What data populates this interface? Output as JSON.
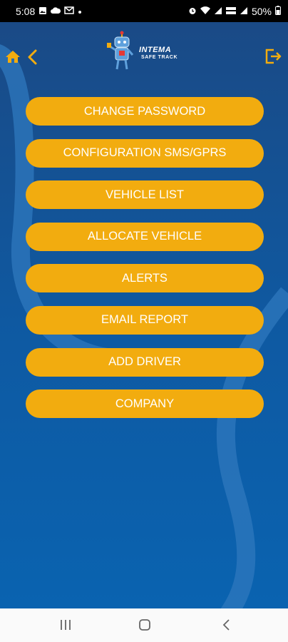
{
  "status_bar": {
    "time": "5:08",
    "battery": "50%",
    "left_icons": [
      "photo-icon",
      "cloud-icon",
      "mail-icon",
      "dot-icon"
    ],
    "right_icons": [
      "alarm-icon",
      "wifi-icon",
      "signal-icon",
      "lte-icon",
      "signal-icon",
      "battery-icon"
    ]
  },
  "header": {
    "logo_title": "INTEMA",
    "logo_subtitle": "SAFE TRACK",
    "icons": [
      "home-icon",
      "back-arrow-icon",
      "logout-icon"
    ]
  },
  "menu": {
    "items": [
      {
        "label": "CHANGE PASSWORD"
      },
      {
        "label": "CONFIGURATION SMS/GPRS"
      },
      {
        "label": "VEHICLE LIST"
      },
      {
        "label": "ALLOCATE VEHICLE"
      },
      {
        "label": "ALERTS"
      },
      {
        "label": "EMAIL REPORT"
      },
      {
        "label": "ADD DRIVER"
      },
      {
        "label": "COMPANY"
      }
    ]
  },
  "nav_bar": {
    "icons": [
      "recent-apps-icon",
      "home-circle-icon",
      "back-chevron-icon"
    ]
  },
  "colors": {
    "accent": "#f2ac0f",
    "background": "#0b4f93",
    "status_bar": "#000000",
    "nav_bar": "#fafafa"
  }
}
